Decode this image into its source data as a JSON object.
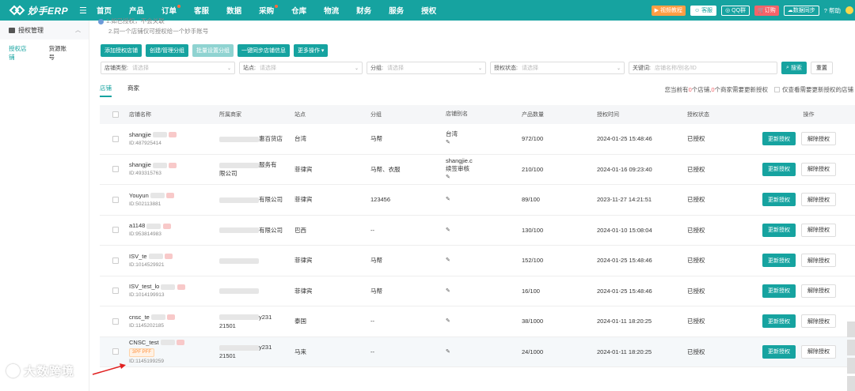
{
  "app": {
    "logo_text": "妙手ERP",
    "brand_color": "#16a3a0"
  },
  "nav": [
    {
      "label": "首页",
      "dot": false
    },
    {
      "label": "产品",
      "dot": false
    },
    {
      "label": "订单",
      "dot": true
    },
    {
      "label": "客服",
      "dot": false
    },
    {
      "label": "数据",
      "dot": false
    },
    {
      "label": "采购",
      "dot": true
    },
    {
      "label": "仓库",
      "dot": false
    },
    {
      "label": "物流",
      "dot": false
    },
    {
      "label": "财务",
      "dot": false
    },
    {
      "label": "服务",
      "dot": false
    },
    {
      "label": "授权",
      "dot": false
    }
  ],
  "topright": {
    "video": "视频教程",
    "service": "客服",
    "qq": "QQ群",
    "order": "订购",
    "sync": "数据同步",
    "help": "帮助"
  },
  "sidebar": {
    "group": "授权管理",
    "tabs": [
      "授权店铺",
      "货源账号"
    ]
  },
  "notice": {
    "line1": "1.如已授权，不会关联",
    "line2": "2.同一个店铺仅可授权给一个妙手账号"
  },
  "actions": [
    "添加授权店铺",
    "创建/管理分组",
    "批量设置分组",
    "一键同步店铺信息",
    "更多操作"
  ],
  "filters": {
    "shop_type": {
      "label": "店铺类型:",
      "placeholder": "请选择"
    },
    "site": {
      "label": "站点:",
      "placeholder": "请选择"
    },
    "group": {
      "label": "分组:",
      "placeholder": "请选择"
    },
    "auth_status": {
      "label": "授权状态:",
      "placeholder": "请选择"
    },
    "keyword": {
      "label": "关键词:",
      "placeholder": "店铺名称/别名/ID"
    },
    "search": "搜索",
    "reset": "重置"
  },
  "tabs": [
    "店铺",
    "商家"
  ],
  "summary": {
    "prefix": "您当前有",
    "shops_count": "0",
    "mid1": "个店铺,",
    "merchants_count": "0",
    "suffix": "个商家需要更新授权",
    "only_label": "仅查看需要更新授权的店铺"
  },
  "table": {
    "headers": [
      "店铺名称",
      "所属商家",
      "站点",
      "分组",
      "店铺别名",
      "产品数量",
      "授权时间",
      "授权状态",
      "操作"
    ],
    "update_label": "更新授权",
    "revoke_label": "解除授权",
    "rows": [
      {
        "name": "shangjie",
        "id": "ID:487925414",
        "merchant1": "惠百货店",
        "merchant2": "",
        "site": "台湾",
        "group": "马帮",
        "alias": "台湾",
        "alias2": "",
        "count": "972/100",
        "time": "2024-01-25 15:48:46",
        "status": "已授权"
      },
      {
        "name": "shangjie",
        "id": "ID:493315763",
        "merchant1": "服务有",
        "merchant2": "限公司",
        "site": "菲律宾",
        "group": "马帮、衣服",
        "alias": "shangjie.c",
        "alias2": "续签审核",
        "count": "210/100",
        "time": "2024-01-16 09:23:40",
        "status": "已授权"
      },
      {
        "name": "Youyun",
        "id": "ID:502113881",
        "merchant1": "有限公司",
        "merchant2": "",
        "site": "菲律宾",
        "group": "123456",
        "alias": "",
        "alias2": "",
        "count": "89/100",
        "time": "2023-11-27 14:21:51",
        "status": "已授权"
      },
      {
        "name": "a1148",
        "id": "ID:953814983",
        "merchant1": "有限公司",
        "merchant2": "",
        "site": "巴西",
        "group": "--",
        "alias": "",
        "alias2": "",
        "count": "130/100",
        "time": "2024-01-10 15:08:04",
        "status": "已授权"
      },
      {
        "name": "ISV_te",
        "id": "ID:1014529921",
        "merchant1": "",
        "merchant2": "",
        "site": "菲律宾",
        "group": "马帮",
        "alias": "",
        "alias2": "",
        "count": "152/100",
        "time": "2024-01-25 15:48:46",
        "status": "已授权"
      },
      {
        "name": "ISV_test_lo",
        "id": "ID:1014199913",
        "merchant1": "",
        "merchant2": "",
        "site": "菲律宾",
        "group": "马帮",
        "alias": "",
        "alias2": "",
        "count": "16/100",
        "time": "2024-01-25 15:48:46",
        "status": "已授权"
      },
      {
        "name": "cnsc_te",
        "id": "ID:1145202185",
        "merchant1": "y231",
        "merchant2": "21501",
        "site": "泰国",
        "group": "--",
        "alias": "",
        "alias2": "",
        "count": "38/1000",
        "time": "2024-01-11 18:20:25",
        "status": "已授权"
      },
      {
        "name": "CNSC_test",
        "id": "ID:1145199259",
        "badge": "3PF PFF",
        "merchant1": "y231",
        "merchant2": "21501",
        "site": "马来",
        "group": "--",
        "alias": "",
        "alias2": "",
        "count": "24/1000",
        "time": "2024-01-11 18:20:25",
        "status": "已授权"
      }
    ]
  },
  "watermark": "大数跨境"
}
